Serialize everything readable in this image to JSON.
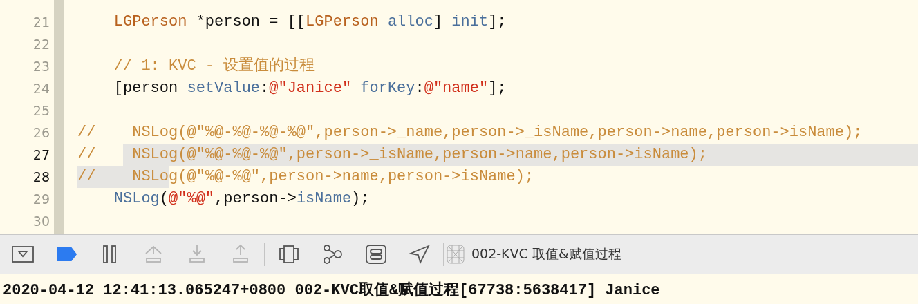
{
  "editor": {
    "lines": [
      {
        "number": "21",
        "selected": false,
        "tokens": [
          {
            "text": "    LGPerson",
            "kind": "type",
            "selected": false
          },
          {
            "text": " *person = [[",
            "kind": "plain",
            "selected": false
          },
          {
            "text": "LGPerson",
            "kind": "type",
            "selected": false
          },
          {
            "text": " alloc",
            "kind": "method",
            "selected": false
          },
          {
            "text": "] ",
            "kind": "plain",
            "selected": false
          },
          {
            "text": "init",
            "kind": "method",
            "selected": false
          },
          {
            "text": "];",
            "kind": "plain",
            "selected": false
          }
        ]
      },
      {
        "number": "22",
        "selected": false
      },
      {
        "number": "23",
        "selected": false,
        "tokens": [
          {
            "text": "    // 1: KVC - 设置值的过程",
            "kind": "comment",
            "selected": false
          }
        ]
      },
      {
        "number": "24",
        "selected": false,
        "tokens": [
          {
            "text": "    [person ",
            "kind": "plain",
            "selected": false
          },
          {
            "text": "setValue",
            "kind": "method",
            "selected": false
          },
          {
            "text": ":",
            "kind": "plain",
            "selected": false
          },
          {
            "text": "@\"Janice\"",
            "kind": "string",
            "selected": false
          },
          {
            "text": " forKey",
            "kind": "method",
            "selected": false
          },
          {
            "text": ":",
            "kind": "plain",
            "selected": false
          },
          {
            "text": "@\"name\"",
            "kind": "string",
            "selected": false
          },
          {
            "text": "];",
            "kind": "plain",
            "selected": false
          }
        ]
      },
      {
        "number": "25",
        "selected": false
      },
      {
        "number": "26",
        "selected": false,
        "tokens": [
          {
            "text": "//    NSLog(@\"%@-%@-%@-%@\",person->_name,person->_isName,person->name,person->isName);",
            "kind": "comment",
            "selected": false
          }
        ]
      },
      {
        "number": "27",
        "selected": true,
        "tokens": [
          {
            "text": "//   ",
            "kind": "comment",
            "selected": false
          },
          {
            "text": " NSLog(@\"%@-%@-%@\",person->_isName,person->name,person->isName);",
            "kind": "comment",
            "selected": true
          }
        ]
      },
      {
        "number": "28",
        "selected": true,
        "tokens": [
          {
            "text": "//    NSLo",
            "kind": "comment",
            "selected": true
          },
          {
            "text": "g(@\"%@-%@\",person->name,person->isName);",
            "kind": "comment",
            "selected": false
          }
        ]
      },
      {
        "number": "29",
        "selected": false,
        "tokens": [
          {
            "text": "    NSLog",
            "kind": "method",
            "selected": false
          },
          {
            "text": "(",
            "kind": "plain",
            "selected": false
          },
          {
            "text": "@\"%@\"",
            "kind": "string",
            "selected": false
          },
          {
            "text": ",person->",
            "kind": "plain",
            "selected": false
          },
          {
            "text": "isName",
            "kind": "method",
            "selected": false
          },
          {
            "text": ");",
            "kind": "plain",
            "selected": false
          }
        ]
      },
      {
        "number": "30",
        "selected": false
      }
    ]
  },
  "debug_bar": {
    "items": [
      {
        "kind": "hide-debug",
        "disabled": false
      },
      {
        "kind": "breakpoints",
        "disabled": false,
        "on": true
      },
      {
        "kind": "pause",
        "disabled": false
      },
      {
        "kind": "step-over",
        "disabled": true
      },
      {
        "kind": "step-into",
        "disabled": true
      },
      {
        "kind": "step-out",
        "disabled": true
      },
      {
        "kind": "separator"
      },
      {
        "kind": "view-debugger",
        "disabled": false
      },
      {
        "kind": "memory-graph",
        "disabled": false
      },
      {
        "kind": "environment",
        "disabled": false
      },
      {
        "kind": "location",
        "disabled": false
      },
      {
        "kind": "separator"
      },
      {
        "kind": "scheme",
        "label": "002-KVC 取值&赋值过程"
      }
    ]
  },
  "console": {
    "output": "2020-04-12 12:41:13.065247+0800 002-KVC取值&赋值过程[67738:5638417] Janice"
  }
}
